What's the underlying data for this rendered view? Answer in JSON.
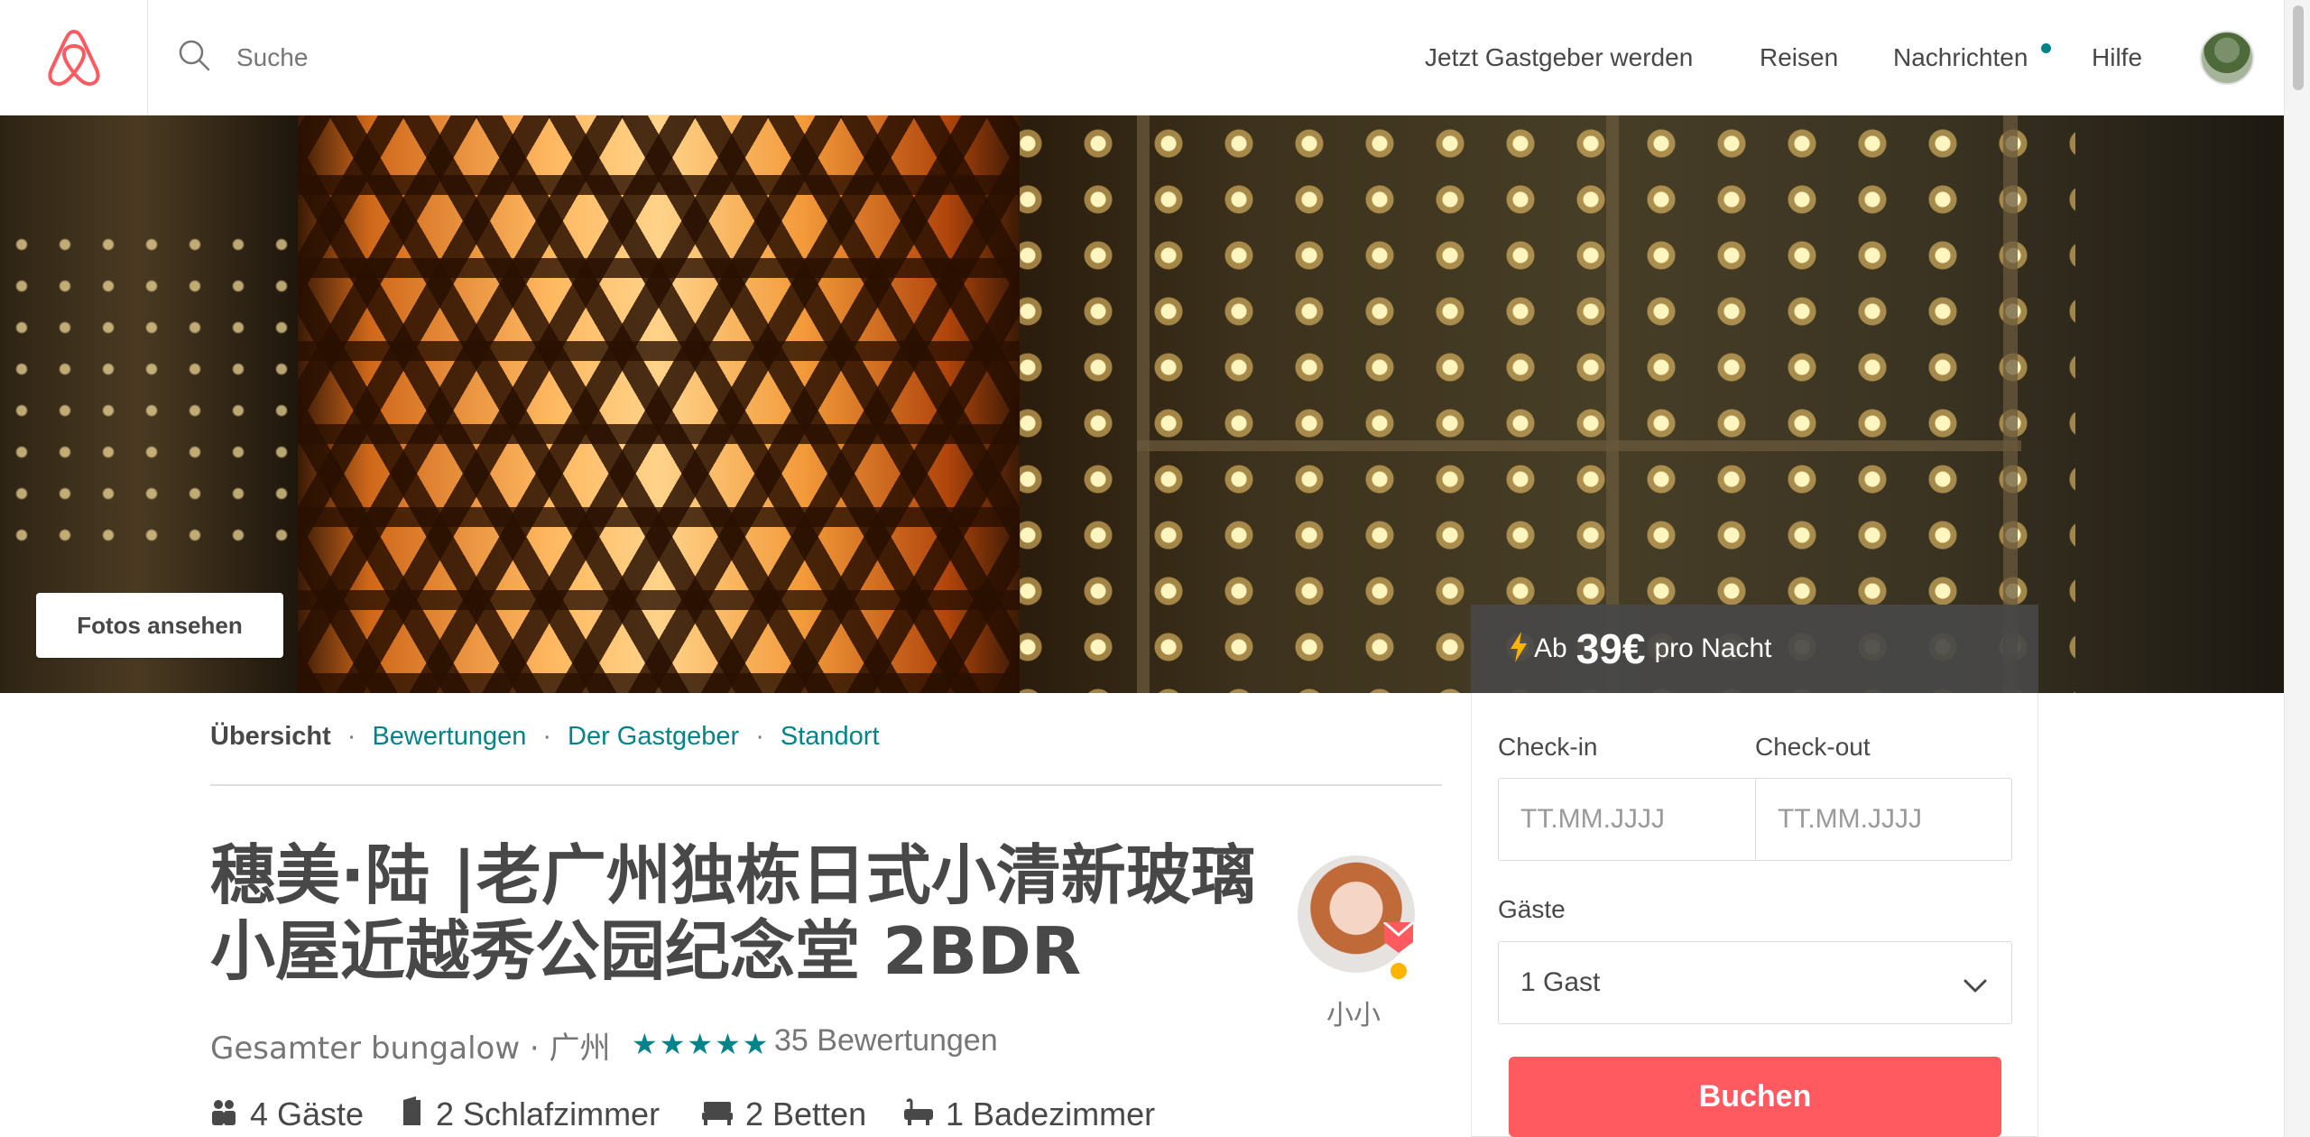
{
  "header": {
    "search_placeholder": "Suche",
    "nav": {
      "host": "Jetzt Gastgeber werden",
      "trips": "Reisen",
      "messages": "Nachrichten",
      "help": "Hilfe"
    }
  },
  "hero": {
    "photos_button": "Fotos ansehen"
  },
  "booking": {
    "price_prefix": "Ab",
    "price": "39€",
    "price_suffix": "pro Nacht",
    "checkin_label": "Check-in",
    "checkout_label": "Check-out",
    "checkin_placeholder": "TT.MM.JJJJ",
    "checkout_placeholder": "TT.MM.JJJJ",
    "guests_label": "Gäste",
    "guests_value": "1 Gast",
    "book_button": "Buchen"
  },
  "subnav": {
    "overview": "Übersicht",
    "reviews": "Bewertungen",
    "host": "Der Gastgeber",
    "location": "Standort",
    "separator": "·"
  },
  "listing": {
    "title_line1": "穗美·陆 |老广州独栋日式小清新玻璃",
    "title_line2": "小屋近越秀公园纪念堂 2BDR",
    "type": "Gesamter bungalow · 广州",
    "stars": "★★★★★",
    "rating": 5,
    "reviews": "35 Bewertungen",
    "host_name": "小小",
    "amenities": {
      "guests": "4 Gäste",
      "bedrooms": "2 Schlafzimmer",
      "beds": "2 Betten",
      "baths": "1 Badezimmer"
    }
  },
  "colors": {
    "brand": "#FF5A5F",
    "link": "#008489",
    "text": "#484848"
  },
  "icons": [
    "airbnb-logo-icon",
    "search-icon",
    "notification-dot-icon",
    "lightning-icon",
    "chevron-down-icon",
    "superhost-badge-icon",
    "guests-icon",
    "door-icon",
    "bed-icon",
    "bathtub-icon"
  ]
}
